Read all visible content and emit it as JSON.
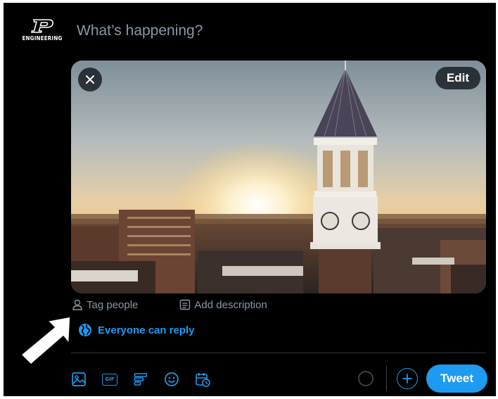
{
  "composer": {
    "logo_text": "ENGINEERING",
    "placeholder": "What’s happening?"
  },
  "media": {
    "close_icon": "close-icon",
    "edit_label": "Edit"
  },
  "media_actions": {
    "tag_people": "Tag people",
    "add_description": "Add description"
  },
  "reply_setting": {
    "label": "Everyone can reply",
    "icon": "globe-icon"
  },
  "toolbar": {
    "icons": [
      "image-icon",
      "gif-icon",
      "poll-icon",
      "emoji-icon",
      "schedule-icon"
    ],
    "gif_label": "GIF"
  },
  "actions": {
    "tweet_label": "Tweet"
  },
  "colors": {
    "accent": "#1d9bf0",
    "background": "#000000",
    "muted": "#8b98a5",
    "divider": "#2f3336"
  }
}
